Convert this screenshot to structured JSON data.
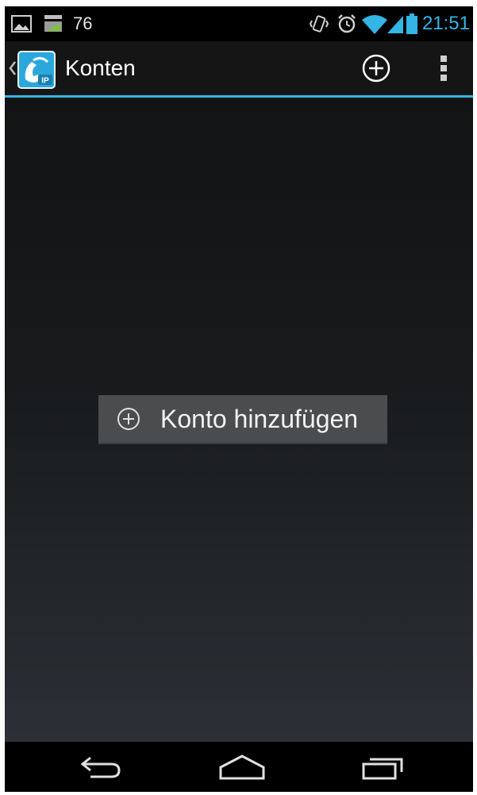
{
  "status_bar": {
    "notification_count": "76",
    "time": "21:51",
    "time_color": "#33b5e5"
  },
  "action_bar": {
    "title": "Konten",
    "accent_color": "#33b5e5",
    "app_icon": "sip-phone-app-icon",
    "app_icon_label": "IP"
  },
  "main": {
    "add_account_label": "Konto hinzufügen"
  },
  "nav_bar": {
    "buttons": [
      "back-icon",
      "home-icon",
      "recent-apps-icon"
    ]
  }
}
